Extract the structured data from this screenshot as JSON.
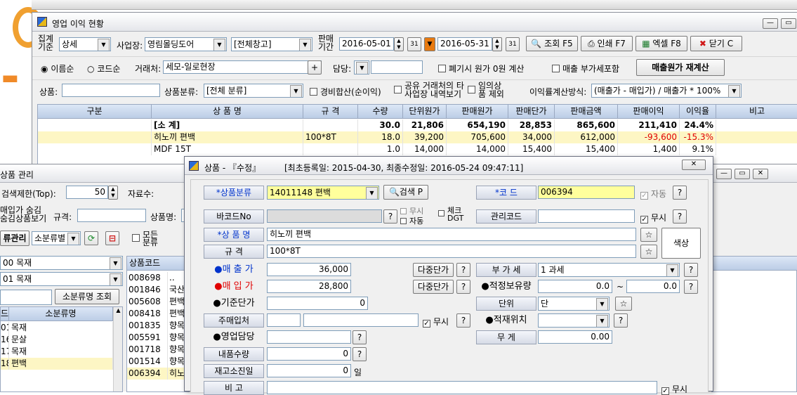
{
  "bg_window": {
    "title": "영업 이익 현황"
  },
  "filter1": {
    "group_label": "집계 기준",
    "group_value": "상세",
    "site_label": "사업장:",
    "site_value": "영림몰딩도어",
    "warehouse_value": "[전체창고]",
    "period_label": "판매 기간",
    "date_from": "2016-05-01",
    "date_to": "2016-05-31",
    "btn_search": "조회 F5",
    "btn_print": "인쇄 F7",
    "btn_excel": "엑셀 F8",
    "btn_close": "닫기 C"
  },
  "filter2": {
    "sort_name": "이름순",
    "sort_code": "코드순",
    "customer_label": "거래처:",
    "customer_value": "세모-일로현장",
    "manager_label": "담당:",
    "cb_zero_cost": "폐기시 원가 0원 계산",
    "cb_vat": "매출 부가세포함",
    "btn_recalc": "매출원가 재계산"
  },
  "filter3": {
    "product_label": "상품:",
    "category_label": "상품분류:",
    "category_value": "[전체 분류]",
    "cb_expense": "경비합산(순이익)",
    "cb_shared": "공유 거래처의 타 사업장 내역보기",
    "cb_arbitrary": "임의상품 제외",
    "calc_label": "이익률계산방식:",
    "calc_value": "(매출가 - 매입가) / 매출가 * 100%"
  },
  "report_grid": {
    "headers": [
      "구분",
      "상 품 명",
      "규 격",
      "수량",
      "단위원가",
      "판매원가",
      "판매단가",
      "판매금액",
      "판매이익",
      "이익율",
      "비고"
    ],
    "rows": [
      {
        "c0": "",
        "c1": "[소 계]",
        "c2": "",
        "c3": "30.0",
        "c4": "21,806",
        "c5": "654,190",
        "c6": "28,853",
        "c7": "865,600",
        "c8": "211,410",
        "c9": "24.4%",
        "c10": ""
      },
      {
        "c0": "",
        "c1": "히노끼 편백",
        "c2": "100*8T",
        "c3": "18.0",
        "c4": "39,200",
        "c5": "705,600",
        "c6": "34,000",
        "c7": "612,000",
        "c8": "-93,600",
        "c9": "-15.3%",
        "c10": ""
      },
      {
        "c0": "",
        "c1": "MDF 15T",
        "c2": "",
        "c3": "1.0",
        "c4": "14,000",
        "c5": "14,000",
        "c6": "15,400",
        "c7": "15,400",
        "c8": "1,400",
        "c9": "9.1%",
        "c10": ""
      }
    ]
  },
  "product_mgmt": {
    "title": "상품 관리",
    "top_label": "검색제한(Top):",
    "top_value": "50",
    "stock_label": "자료수:",
    "hide_label": "매입가 숨김 숨김상품보기",
    "spec_label": "규격:",
    "name_label": "상품명:",
    "tab_category": "류관리",
    "small_category": "소분류별",
    "cb_all": "모든 분류",
    "combo1": "00 목재",
    "combo2": "01 목재",
    "btn_small_search": "소분류명 조회",
    "cat_headers": [
      "드",
      "소분류명"
    ],
    "cat_rows": [
      [
        "01",
        "목재"
      ],
      [
        "16",
        "문살"
      ],
      [
        "17",
        "목재"
      ],
      [
        "18",
        "편백"
      ]
    ],
    "code_header": "상품코드",
    "codes": [
      [
        "008698",
        ".."
      ],
      [
        "001846",
        "국산"
      ],
      [
        "005608",
        "편백"
      ],
      [
        "008418",
        "편백"
      ],
      [
        "001835",
        "향목"
      ],
      [
        "005591",
        "향목"
      ],
      [
        "001718",
        "향목"
      ],
      [
        "001514",
        "향목"
      ],
      [
        "006394",
        "히노"
      ]
    ]
  },
  "dialog": {
    "title": "상품 - 『수정』",
    "meta": "[최초등록일: 2015-04-30, 최종수정일: 2016-05-24 09:47:11]",
    "category_label": "*상품분류",
    "category_value": "14011148 편백",
    "btn_search": "검색 P",
    "code_label": "*코    드",
    "code_value": "006394",
    "auto_code": "자동",
    "barcode_label": "바코드No",
    "cb_ignore": "무시",
    "cb_auto": "자동",
    "cb_check": "체크 DGT",
    "mgmt_code_label": "관리코드",
    "cb_ignore2": "무시",
    "name_label": "*상 품 명",
    "name_value": "히노끼 편백",
    "color_button": "색상",
    "spec_label": "규    격",
    "spec_value": "100*8T",
    "sale_label": "●매 출 가",
    "sale_value": "36,000",
    "purchase_label": "●매 입 가",
    "purchase_value": "28,800",
    "std_label": "●기준단가",
    "std_value": "0",
    "main_supplier_label": "주매입처",
    "cb_ignore3": "무시",
    "sales_mgr_label": "●영업담당",
    "delivery_qty_label": "내품수량",
    "delivery_qty_value": "0",
    "stock_days_label": "재고소진일",
    "stock_days_value": "0",
    "days_unit": "일",
    "note_label": "비    고",
    "cb_ignore4": "무시",
    "multi_price1": "다중단가",
    "multi_price2": "다중단가",
    "vat_label": "부 가 세",
    "vat_value": "1 과세",
    "proper_stock_label": "●적정보유량",
    "proper_stock_min": "0.0",
    "proper_stock_max": "0.0",
    "tilde": "~",
    "unit_label": "단위",
    "unit_value": "단",
    "location_label": "●적재위치",
    "weight_label": "무    게",
    "weight_value": "0.00"
  },
  "colors": {
    "yellow_field": "#ffff9c",
    "grid_header": "#c8d6ec",
    "highlight_row": "#fdf6c4",
    "red_label": "#e00000",
    "blue_label": "#0033cc"
  }
}
